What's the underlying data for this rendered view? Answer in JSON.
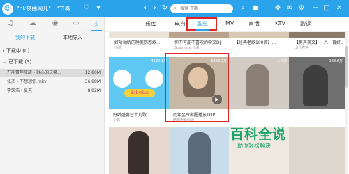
{
  "titlebar": {
    "title": "\"ok夜曲网儿\"…\"节奏…",
    "search_placeholder": "搜钟 丁斯",
    "bg_color": "#2aa3ea"
  },
  "sidebar": {
    "tabs": [
      "我的下载",
      "本地导入"
    ],
    "downloading_label": "下载中 (0)",
    "downloaded_label": "已下载 (3)",
    "items": [
      {
        "name": "万能青年旅店 - 揪心的玩笑...",
        "size": "12.80M"
      },
      {
        "name": "张杰 - 不想想你.mkv",
        "size": "36.88M"
      },
      {
        "name": "李荣浩 - 夏天",
        "size": "8.82M"
      }
    ]
  },
  "nav": {
    "tabs": [
      "乐库",
      "电台",
      "歌单",
      "MV",
      "直播",
      "KTV",
      "歌词"
    ],
    "active": "歌单",
    "accent": "#2aa3ea",
    "highlight_color": "#e02626"
  },
  "content": {
    "top_row": [
      {
        "title": "好听动听的睡美伤感歌...",
        "sub": "小筑"
      },
      {
        "title": "你不可能不喜欢的中文DJ",
        "sub": "Soulmate 元湘"
      },
      {
        "title": "【经典老歌100首】...",
        "sub": ""
      },
      {
        "title": "【男声英文】一人一首好...",
        "sub": "山丘君子"
      }
    ],
    "cards": [
      {
        "plays": "4130.3万",
        "title": "好听盛宴巴士儿歌",
        "sub": "小筑",
        "palette": "#5fc8f2"
      },
      {
        "plays": "6363.2万",
        "title": "历年至今影圈播放TOP...",
        "sub": "酷狗电影频道",
        "palette": "#c7b9a6"
      },
      {
        "plays": "1.4万",
        "title": "",
        "sub": "",
        "palette": "#d2ccc4"
      },
      {
        "plays": "168.6万",
        "title": "",
        "sub": "",
        "palette": "#6f6f6f"
      }
    ]
  },
  "watermark": {
    "main": "百科全说",
    "sub": "助你轻松解决"
  }
}
